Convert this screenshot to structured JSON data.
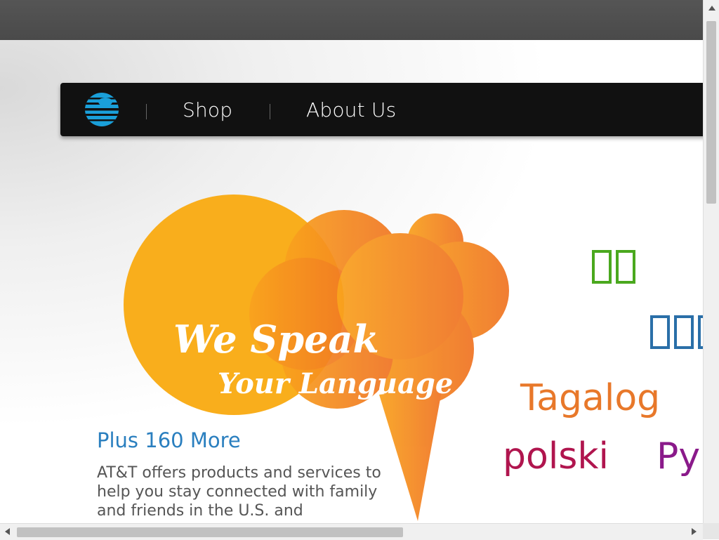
{
  "nav": {
    "logo_icon": "att-globe-icon",
    "links": [
      {
        "label": "Shop"
      },
      {
        "label": "About Us"
      }
    ]
  },
  "hero": {
    "line1": "We Speak",
    "line2": "Your Language"
  },
  "content": {
    "heading": "Plus 160 More",
    "description": "AT&T offers products and services to help you stay connected with family and friends in the U.S. and"
  },
  "languages": {
    "tagalog": "Tagalog",
    "polish": "polski",
    "russian_partial": "Py"
  },
  "colors": {
    "nav_bg": "#111111",
    "link_blue": "#2a7fbf",
    "hero_orange": "#f7a51c",
    "cloud_orange": "#f07a22"
  }
}
